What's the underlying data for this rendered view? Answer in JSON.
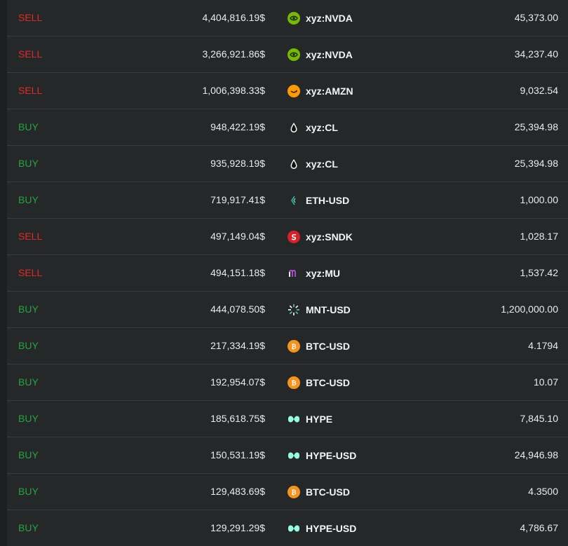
{
  "colors": {
    "sell": "#e02a2a",
    "buy": "#27a243",
    "background": "#252829",
    "divider": "#3a3d3f"
  },
  "trades": [
    {
      "side": "SELL",
      "value": "4,404,816.19$",
      "asset": "xyz:NVDA",
      "icon": "nvda-icon",
      "qty": "45,373.00"
    },
    {
      "side": "SELL",
      "value": "3,266,921.86$",
      "asset": "xyz:NVDA",
      "icon": "nvda-icon",
      "qty": "34,237.40"
    },
    {
      "side": "SELL",
      "value": "1,006,398.33$",
      "asset": "xyz:AMZN",
      "icon": "amzn-icon",
      "qty": "9,032.54"
    },
    {
      "side": "BUY",
      "value": "948,422.19$",
      "asset": "xyz:CL",
      "icon": "oil-drop-icon",
      "qty": "25,394.98"
    },
    {
      "side": "BUY",
      "value": "935,928.19$",
      "asset": "xyz:CL",
      "icon": "oil-drop-icon",
      "qty": "25,394.98"
    },
    {
      "side": "BUY",
      "value": "719,917.41$",
      "asset": "ETH-USD",
      "icon": "eth-icon",
      "qty": "1,000.00"
    },
    {
      "side": "SELL",
      "value": "497,149.04$",
      "asset": "xyz:SNDK",
      "icon": "sndk-icon",
      "qty": "1,028.17"
    },
    {
      "side": "SELL",
      "value": "494,151.18$",
      "asset": "xyz:MU",
      "icon": "mu-icon",
      "qty": "1,537.42"
    },
    {
      "side": "BUY",
      "value": "444,078.50$",
      "asset": "MNT-USD",
      "icon": "mnt-icon",
      "qty": "1,200,000.00"
    },
    {
      "side": "BUY",
      "value": "217,334.19$",
      "asset": "BTC-USD",
      "icon": "btc-icon",
      "qty": "4.1794"
    },
    {
      "side": "BUY",
      "value": "192,954.07$",
      "asset": "BTC-USD",
      "icon": "btc-icon",
      "qty": "10.07"
    },
    {
      "side": "BUY",
      "value": "185,618.75$",
      "asset": "HYPE",
      "icon": "hype-icon",
      "qty": "7,845.10"
    },
    {
      "side": "BUY",
      "value": "150,531.19$",
      "asset": "HYPE-USD",
      "icon": "hype-icon",
      "qty": "24,946.98"
    },
    {
      "side": "BUY",
      "value": "129,483.69$",
      "asset": "BTC-USD",
      "icon": "btc-icon",
      "qty": "4.3500"
    },
    {
      "side": "BUY",
      "value": "129,291.29$",
      "asset": "HYPE-USD",
      "icon": "hype-icon",
      "qty": "4,786.67"
    }
  ]
}
